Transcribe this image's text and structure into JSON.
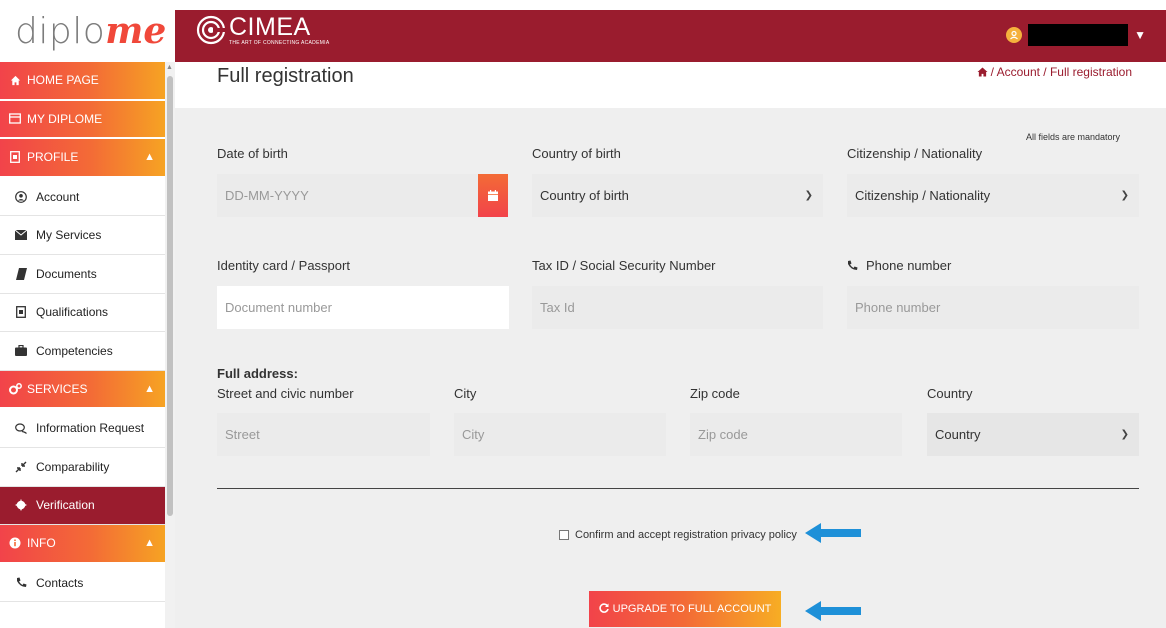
{
  "brand": {
    "text_plain": "diplo",
    "text_accent": "me"
  },
  "header": {
    "org_name": "CIMEA",
    "org_tagline": "THE ART OF CONNECTING ACADEMIA",
    "accent_color": "#9a1c2e"
  },
  "sidebar": {
    "items": [
      {
        "label": "HOME PAGE",
        "icon": "home-icon"
      },
      {
        "label": "MY DIPLOME",
        "icon": "card-icon"
      },
      {
        "label": "PROFILE",
        "icon": "profile-icon"
      },
      {
        "label": "Account",
        "icon": "user-circle-icon"
      },
      {
        "label": "My Services",
        "icon": "envelope-icon"
      },
      {
        "label": "Documents",
        "icon": "book-icon"
      },
      {
        "label": "Qualifications",
        "icon": "file-icon"
      },
      {
        "label": "Competencies",
        "icon": "briefcase-icon"
      },
      {
        "label": "SERVICES",
        "icon": "cogs-icon"
      },
      {
        "label": "Information Request",
        "icon": "comments-icon"
      },
      {
        "label": "Comparability",
        "icon": "compress-icon"
      },
      {
        "label": "Verification",
        "icon": "certificate-icon"
      },
      {
        "label": "INFO",
        "icon": "info-icon"
      },
      {
        "label": "Contacts",
        "icon": "phone-icon"
      }
    ]
  },
  "page": {
    "title": "Full registration",
    "breadcrumb": "/ Account / Full registration",
    "mandatory_note": "All fields are mandatory"
  },
  "form": {
    "dob": {
      "label": "Date of birth",
      "placeholder": "DD-MM-YYYY"
    },
    "country_of_birth": {
      "label": "Country of birth",
      "value": "Country of birth"
    },
    "citizenship": {
      "label": "Citizenship / Nationality",
      "value": "Citizenship / Nationality"
    },
    "identity": {
      "label": "Identity card / Passport",
      "placeholder": "Document number"
    },
    "tax": {
      "label": "Tax ID / Social Security Number",
      "placeholder": "Tax Id"
    },
    "phone": {
      "label": "Phone number",
      "placeholder": "Phone number"
    },
    "address_title": "Full address:",
    "street": {
      "label": "Street and civic number",
      "placeholder": "Street"
    },
    "city": {
      "label": "City",
      "placeholder": "City"
    },
    "zip": {
      "label": "Zip code",
      "placeholder": "Zip code"
    },
    "country": {
      "label": "Country",
      "value": "Country"
    },
    "privacy_label": "Confirm and accept registration privacy policy",
    "submit_label": "UPGRADE TO FULL ACCOUNT"
  }
}
